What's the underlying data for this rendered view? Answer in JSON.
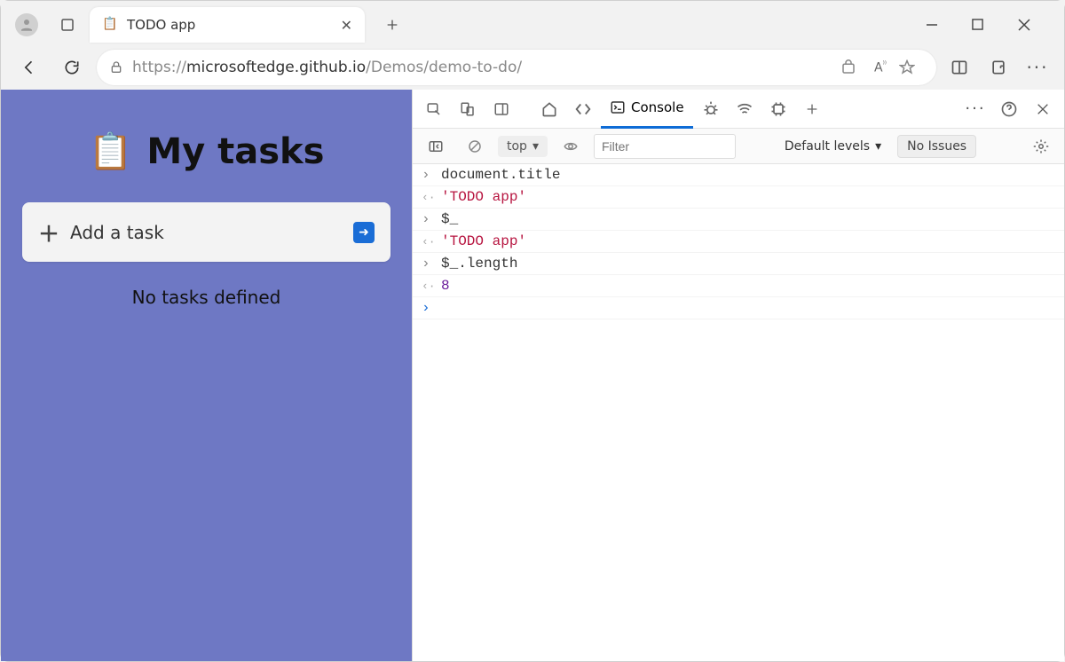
{
  "browser": {
    "tab_title": "TODO app",
    "url_prefix": "https://",
    "url_host": "microsoftedge.github.io",
    "url_path": "/Demos/demo-to-do/"
  },
  "app": {
    "emoji": "📋",
    "heading": "My tasks",
    "add_label": "Add a task",
    "empty": "No tasks defined"
  },
  "devtools": {
    "tabs": {
      "console": "Console"
    },
    "toolbar": {
      "context": "top",
      "filter_placeholder": "Filter",
      "levels": "Default levels",
      "no_issues": "No Issues"
    },
    "entries": [
      {
        "kind": "input",
        "text": "document.title"
      },
      {
        "kind": "output",
        "text": "'TODO app'",
        "cls": "string"
      },
      {
        "kind": "input",
        "text": "$_"
      },
      {
        "kind": "output",
        "text": "'TODO app'",
        "cls": "string"
      },
      {
        "kind": "input",
        "text": "$_.length"
      },
      {
        "kind": "output",
        "text": "8",
        "cls": "number"
      }
    ]
  }
}
